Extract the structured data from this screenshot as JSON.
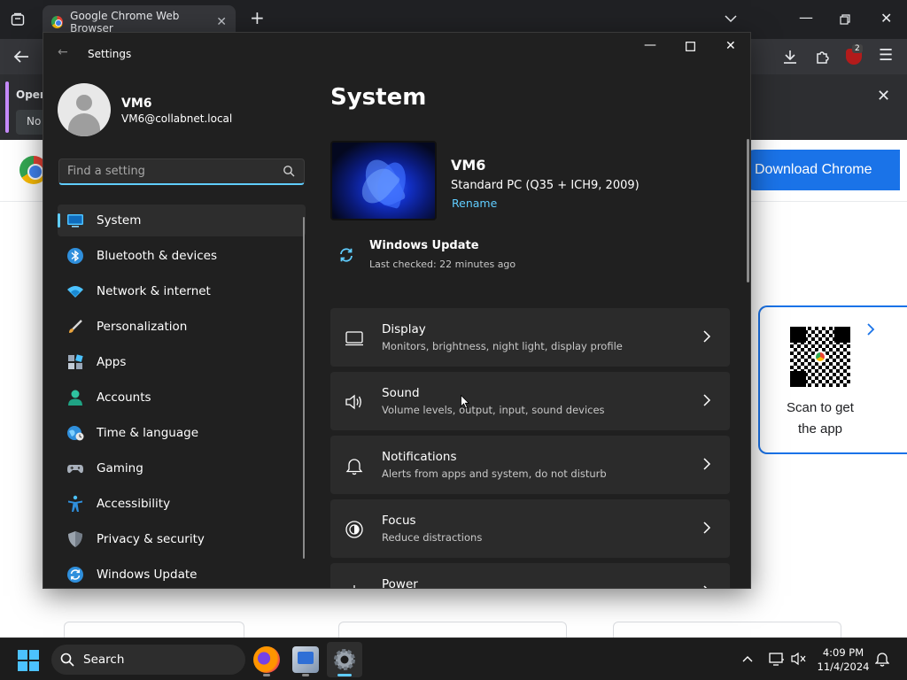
{
  "chrome": {
    "tab_title": "Google Chrome Web Browser",
    "info_bar_title": "Open",
    "info_bar_button": "No",
    "download_button": "Download Chrome",
    "qr_text_line1": "Scan to get",
    "qr_text_line2": "the app",
    "extension_badge": "2",
    "brand_color": "#1a73e8"
  },
  "settings": {
    "window_title": "Settings",
    "user": {
      "name": "VM6",
      "email": "VM6@collabnet.local"
    },
    "search_placeholder": "Find a setting",
    "nav": [
      {
        "label": "System",
        "icon": "system-icon",
        "active": true
      },
      {
        "label": "Bluetooth & devices",
        "icon": "bluetooth-icon"
      },
      {
        "label": "Network & internet",
        "icon": "wifi-icon"
      },
      {
        "label": "Personalization",
        "icon": "brush-icon"
      },
      {
        "label": "Apps",
        "icon": "apps-icon"
      },
      {
        "label": "Accounts",
        "icon": "accounts-icon"
      },
      {
        "label": "Time & language",
        "icon": "globe-clock-icon"
      },
      {
        "label": "Gaming",
        "icon": "gamepad-icon"
      },
      {
        "label": "Accessibility",
        "icon": "accessibility-icon"
      },
      {
        "label": "Privacy & security",
        "icon": "shield-icon"
      },
      {
        "label": "Windows Update",
        "icon": "update-icon"
      }
    ],
    "page_title": "System",
    "pc": {
      "name": "VM6",
      "model": "Standard PC (Q35 + ICH9, 2009)",
      "rename": "Rename"
    },
    "windows_update": {
      "title": "Windows Update",
      "subtitle": "Last checked: 22 minutes ago"
    },
    "cards": [
      {
        "title": "Display",
        "subtitle": "Monitors, brightness, night light, display profile",
        "icon": "monitor-icon"
      },
      {
        "title": "Sound",
        "subtitle": "Volume levels, output, input, sound devices",
        "icon": "speaker-icon"
      },
      {
        "title": "Notifications",
        "subtitle": "Alerts from apps and system, do not disturb",
        "icon": "bell-icon"
      },
      {
        "title": "Focus",
        "subtitle": "Reduce distractions",
        "icon": "focus-icon"
      },
      {
        "title": "Power",
        "subtitle": "",
        "icon": "power-icon"
      }
    ],
    "accent_color": "#60cdff"
  },
  "taskbar": {
    "search_label": "Search",
    "time": "4:09 PM",
    "date": "11/4/2024"
  }
}
